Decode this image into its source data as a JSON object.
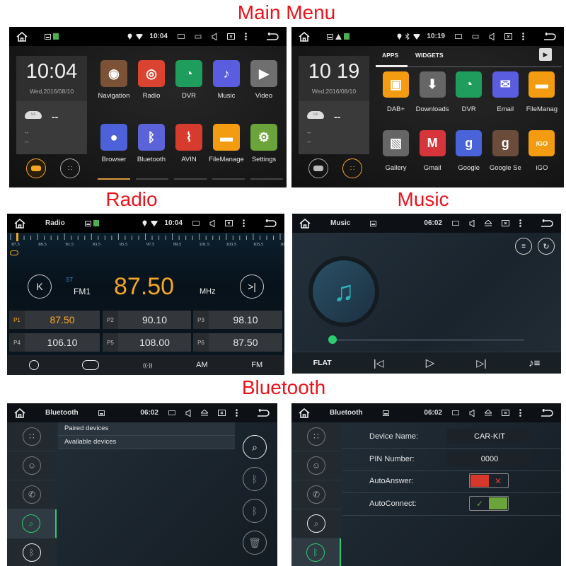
{
  "titles": {
    "main_menu": "Main Menu",
    "radio": "Radio",
    "music": "Music",
    "bluetooth": "Bluetooth"
  },
  "colors": {
    "title": "#e8141c",
    "accent_orange": "#f5a623",
    "accent_green": "#2ecc71",
    "toggle_off": "#d8382b",
    "toggle_on": "#6aa43a"
  },
  "home_screen": {
    "status_time": "10:04",
    "clock": {
      "time": "10:04",
      "date": "Wed,2016/08/10"
    },
    "weather": {
      "badge": "NA",
      "temp": "--",
      "line1": "--",
      "line2": "--"
    },
    "apps": [
      {
        "label": "Navigation",
        "icon": "map-pin-icon",
        "color": "#7b5236"
      },
      {
        "label": "Radio",
        "icon": "radio-antenna-icon",
        "color": "#d9432f"
      },
      {
        "label": "DVR",
        "icon": "dashcam-gauge-icon",
        "color": "#1f9d5c"
      },
      {
        "label": "Music",
        "icon": "music-note-icon",
        "color": "#5a5de0"
      },
      {
        "label": "Video",
        "icon": "play-icon",
        "color": "#6f6f6f"
      },
      {
        "label": "Browser",
        "icon": "globe-icon",
        "color": "#4d62d9"
      },
      {
        "label": "Bluetooth",
        "icon": "bluetooth-icon",
        "color": "#5c62d8"
      },
      {
        "label": "AVIN",
        "icon": "av-cable-icon",
        "color": "#d63b2e"
      },
      {
        "label": "FileManage",
        "icon": "folder-icon",
        "color": "#f39c12"
      },
      {
        "label": "Settings",
        "icon": "gear-icon",
        "color": "#6aa43a"
      }
    ],
    "pages": 5,
    "active_page": 1,
    "active_button": "car"
  },
  "apps_drawer": {
    "status_time": "10:19",
    "clock": {
      "time": "10 19",
      "date": "Wed,2016/08/10"
    },
    "weather": {
      "badge": "NA",
      "temp": "--",
      "line1": "--",
      "line2": "--"
    },
    "tabs": [
      {
        "label": "APPS",
        "active": true
      },
      {
        "label": "WIDGETS",
        "active": false
      }
    ],
    "apps": [
      {
        "label": "DAB+",
        "icon": "radio-icon",
        "color": "#f39c12"
      },
      {
        "label": "Downloads",
        "icon": "download-icon",
        "color": "#666666"
      },
      {
        "label": "DVR",
        "icon": "dashcam-gauge-icon",
        "color": "#1f9d5c"
      },
      {
        "label": "Email",
        "icon": "email-icon",
        "color": "#5a5de0"
      },
      {
        "label": "FileManag",
        "icon": "folder-icon",
        "color": "#f39c12"
      },
      {
        "label": "Gallery",
        "icon": "gallery-icon",
        "color": "#666666"
      },
      {
        "label": "Gmail",
        "icon": "gmail-icon",
        "color": "#d6363b"
      },
      {
        "label": "Google",
        "icon": "google-icon",
        "color": "#4a63d8"
      },
      {
        "label": "Google Se",
        "icon": "google-settings-icon",
        "color": "#6b4c3b"
      },
      {
        "label": "iGO",
        "icon": "igo-icon",
        "color": "#f39c12"
      }
    ],
    "active_button": "apps"
  },
  "radio": {
    "title": "Radio",
    "status_time": "10:04",
    "scale_labels": [
      "87.5",
      "89.5",
      "91.5",
      "93.5",
      "95.5",
      "97.5",
      "99.5",
      "101.5",
      "103.5",
      "105.5",
      "107.5"
    ],
    "stereo": "ST",
    "band": "FM1",
    "frequency": "87.50",
    "unit": "MHz",
    "presets": [
      {
        "label": "P1",
        "freq": "87.50",
        "active": true
      },
      {
        "label": "P2",
        "freq": "90.10",
        "active": false
      },
      {
        "label": "P3",
        "freq": "98.10",
        "active": false
      },
      {
        "label": "P4",
        "freq": "106.10",
        "active": false
      },
      {
        "label": "P5",
        "freq": "108.00",
        "active": false
      },
      {
        "label": "P6",
        "freq": "87.50",
        "active": false
      }
    ],
    "bottom": {
      "am": "AM",
      "fm": "FM"
    }
  },
  "music": {
    "title": "Music",
    "status_time": "06:02",
    "eq": "FLAT",
    "progress": 0
  },
  "bt_devices": {
    "title": "Bluetooth",
    "status_time": "06:02",
    "list": [
      "Paired devices",
      "Available devices"
    ],
    "active_tab": "search"
  },
  "bt_settings": {
    "title": "Bluetooth",
    "status_time": "06:02",
    "device_name_label": "Device Name:",
    "device_name": "CAR-KIT",
    "pin_label": "PIN Number:",
    "pin": "0000",
    "auto_answer_label": "AutoAnswer:",
    "auto_answer": false,
    "auto_connect_label": "AutoConnect:",
    "auto_connect": true,
    "active_tab": "settings"
  }
}
